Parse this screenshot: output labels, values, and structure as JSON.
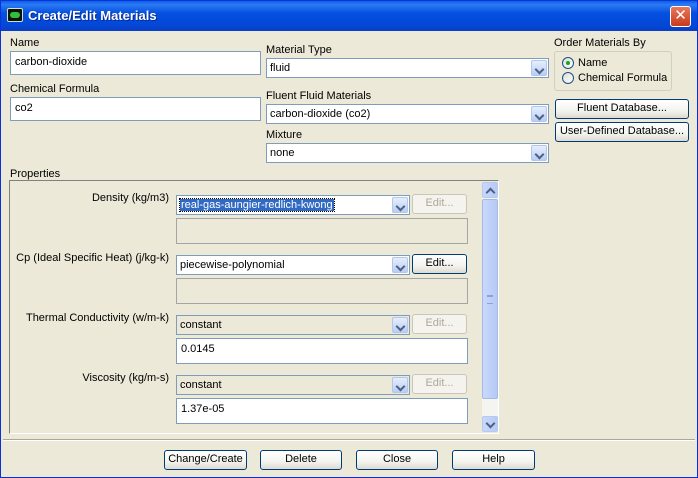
{
  "window": {
    "title": "Create/Edit Materials",
    "close_glyph": "✕"
  },
  "name": {
    "label": "Name",
    "value": "carbon-dioxide"
  },
  "chemical_formula": {
    "label": "Chemical Formula",
    "value": "co2"
  },
  "material_type": {
    "label": "Material Type",
    "value": "fluid"
  },
  "fluent_fluid_materials": {
    "label": "Fluent Fluid Materials",
    "value": "carbon-dioxide (co2)"
  },
  "mixture": {
    "label": "Mixture",
    "value": "none"
  },
  "order_by": {
    "label": "Order Materials By",
    "options": [
      {
        "label": "Name",
        "selected": true
      },
      {
        "label": "Chemical Formula",
        "selected": false
      }
    ]
  },
  "database_buttons": {
    "fluent": "Fluent Database...",
    "user_defined": "User-Defined Database..."
  },
  "properties": {
    "label": "Properties",
    "rows": [
      {
        "label": "Density (kg/m3)",
        "method": "real-gas-aungier-redlich-kwong",
        "edit": "Edit...",
        "edit_enabled": false,
        "value": ""
      },
      {
        "label": "Cp (Ideal Specific Heat) (j/kg-k)",
        "method": "piecewise-polynomial",
        "edit": "Edit...",
        "edit_enabled": true,
        "value": ""
      },
      {
        "label": "Thermal Conductivity (w/m-k)",
        "method": "constant",
        "edit": "Edit...",
        "edit_enabled": false,
        "value": "0.0145"
      },
      {
        "label": "Viscosity (kg/m-s)",
        "method": "constant",
        "edit": "Edit...",
        "edit_enabled": false,
        "value": "1.37e-05"
      }
    ]
  },
  "footer": {
    "change_create": "Change/Create",
    "delete": "Delete",
    "close": "Close",
    "help": "Help"
  },
  "colors": {
    "titlebar": "#0550e0",
    "dialog_bg": "#ece9d8",
    "selection": "#316ac5"
  }
}
